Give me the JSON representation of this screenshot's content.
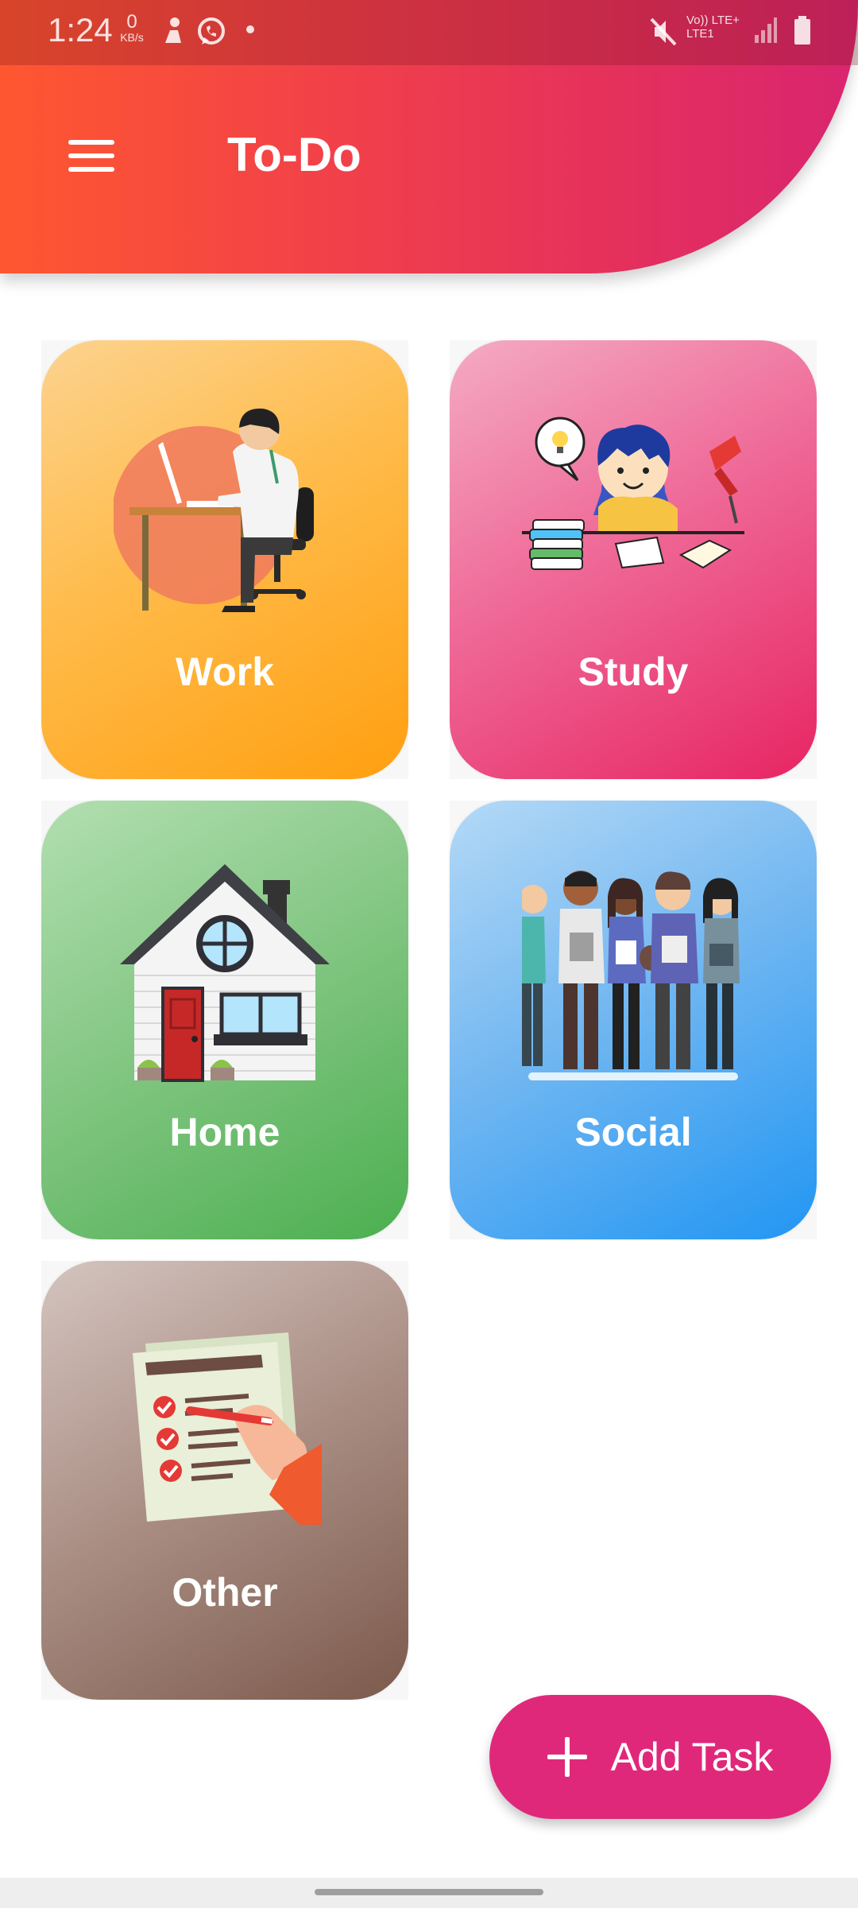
{
  "status_bar": {
    "time": "1:24",
    "net_speed_value": "0",
    "net_speed_unit": "KB/s",
    "network_line1": "Vo)) LTE+",
    "network_line2": "LTE1"
  },
  "app_bar": {
    "title": "To-Do",
    "menu_icon": "hamburger-menu-icon",
    "gradient_colors": [
      "#fe5730",
      "#d9256f"
    ]
  },
  "categories": [
    {
      "label": "Work",
      "icon": "person-at-desk-illustration",
      "colors": [
        "#fcd38f",
        "#ff9f10"
      ]
    },
    {
      "label": "Study",
      "icon": "student-studying-illustration",
      "colors": [
        "#f4abc4",
        "#e72563"
      ]
    },
    {
      "label": "Home",
      "icon": "house-illustration",
      "colors": [
        "#b2dfb0",
        "#4caf50"
      ]
    },
    {
      "label": "Social",
      "icon": "group-of-people-illustration",
      "colors": [
        "#b4d9f6",
        "#2196f3"
      ]
    },
    {
      "label": "Other",
      "icon": "checklist-illustration",
      "colors": [
        "#d4c4bf",
        "#7c5a4c"
      ]
    }
  ],
  "fab": {
    "label": "Add Task",
    "icon": "plus-icon",
    "color": "#e0287a"
  }
}
